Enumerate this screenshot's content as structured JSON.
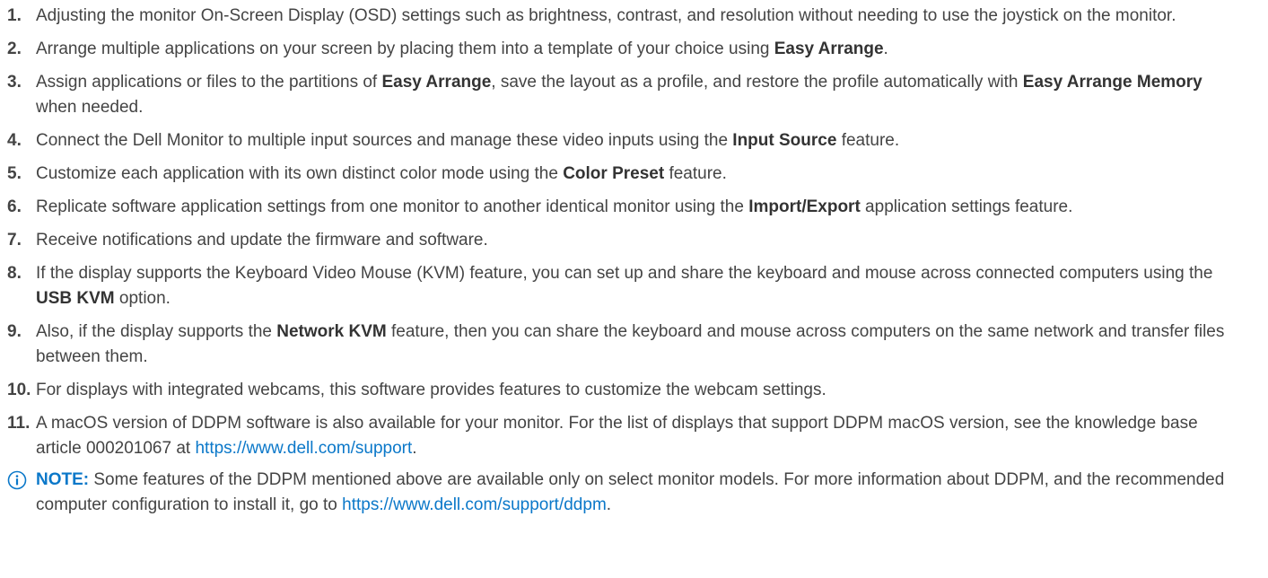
{
  "items": [
    {
      "num": "1.",
      "parts": [
        {
          "t": "Adjusting the monitor On-Screen Display (OSD) settings such as brightness, contrast, and resolution without needing to use the joystick on the monitor."
        }
      ]
    },
    {
      "num": "2.",
      "parts": [
        {
          "t": "Arrange multiple applications on your screen by placing them into a template of your choice using "
        },
        {
          "t": "Easy Arrange",
          "b": true
        },
        {
          "t": "."
        }
      ]
    },
    {
      "num": "3.",
      "parts": [
        {
          "t": "Assign applications or files to the partitions of "
        },
        {
          "t": "Easy Arrange",
          "b": true
        },
        {
          "t": ", save the layout as a profile, and restore the profile automatically with "
        },
        {
          "t": "Easy Arrange Memory",
          "b": true
        },
        {
          "t": " when needed."
        }
      ]
    },
    {
      "num": "4.",
      "parts": [
        {
          "t": "Connect the Dell Monitor to multiple input sources and manage these video inputs using the "
        },
        {
          "t": "Input Source",
          "b": true
        },
        {
          "t": " feature."
        }
      ]
    },
    {
      "num": "5.",
      "parts": [
        {
          "t": "Customize each application with its own distinct color mode using the "
        },
        {
          "t": "Color Preset",
          "b": true
        },
        {
          "t": " feature."
        }
      ]
    },
    {
      "num": "6.",
      "parts": [
        {
          "t": "Replicate software application settings from one monitor to another identical monitor using the "
        },
        {
          "t": "Import/Export",
          "b": true
        },
        {
          "t": " application settings feature."
        }
      ]
    },
    {
      "num": "7.",
      "parts": [
        {
          "t": "Receive notifications and update the firmware and software."
        }
      ]
    },
    {
      "num": "8.",
      "parts": [
        {
          "t": "If the display supports the Keyboard Video Mouse (KVM) feature, you can set up and share the keyboard and mouse across connected computers using the "
        },
        {
          "t": "USB KVM",
          "b": true
        },
        {
          "t": " option."
        }
      ]
    },
    {
      "num": "9.",
      "parts": [
        {
          "t": "Also, if the display supports the "
        },
        {
          "t": "Network KVM",
          "b": true
        },
        {
          "t": " feature, then you can share the keyboard and mouse across computers on the same network and transfer files between them."
        }
      ]
    },
    {
      "num": "10.",
      "parts": [
        {
          "t": "For displays with integrated webcams, this software provides features to customize the webcam settings."
        }
      ]
    },
    {
      "num": "11.",
      "parts": [
        {
          "t": "A macOS version of DDPM software is also available for your monitor. For the list of displays that support DDPM macOS version, see the knowledge base article 000201067 at "
        },
        {
          "t": "https://www.dell.com/support",
          "link": true
        },
        {
          "t": "."
        }
      ]
    }
  ],
  "note": {
    "icon": "info-circle-icon",
    "icon_color": "#0b78c9",
    "label": "NOTE:",
    "parts": [
      {
        "t": " Some features of the DDPM mentioned above are available only on select monitor models. For more information about DDPM, and the recommended computer configuration to install it, go to "
      },
      {
        "t": "https://www.dell.com/support/ddpm",
        "link": true
      },
      {
        "t": "."
      }
    ]
  }
}
